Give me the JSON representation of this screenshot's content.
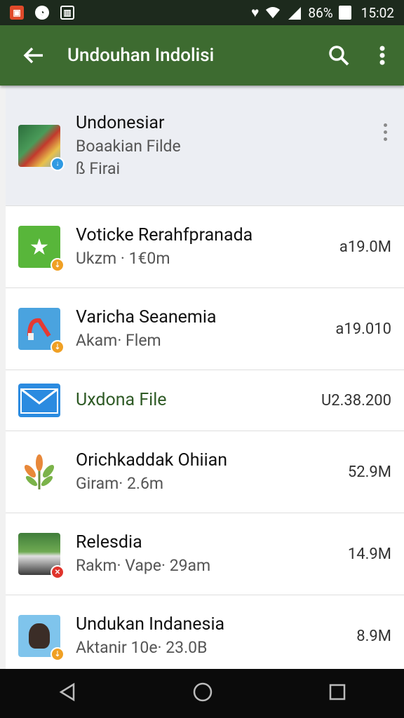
{
  "status": {
    "battery": "86%",
    "time": "15:02"
  },
  "appbar": {
    "title": "Undouhan Indolisi"
  },
  "items": [
    {
      "title": "Undonesiar",
      "line2": "Boaakian Filde",
      "line3": "ß Firai",
      "size": ""
    },
    {
      "title": "Voticke Rerahfpranada",
      "line2": "Ukzm · 1€0m",
      "size": "a19.0M"
    },
    {
      "title": "Varicha Seanemia",
      "line2": "Akam· Flem",
      "size": "a19.010"
    },
    {
      "title": "Uxdona File",
      "line2": "",
      "size": "U2.38.200"
    },
    {
      "title": "Orichkaddak Ohiian",
      "line2": "Giram· 2.6m",
      "size": "52.9M"
    },
    {
      "title": "Relesdia",
      "line2": "Rakm· Vape· 29am",
      "size": "14.9M"
    },
    {
      "title": "Undukan Indanesia",
      "line2": "Aktanir 10e· 23.0B",
      "size": "8.9M"
    }
  ]
}
